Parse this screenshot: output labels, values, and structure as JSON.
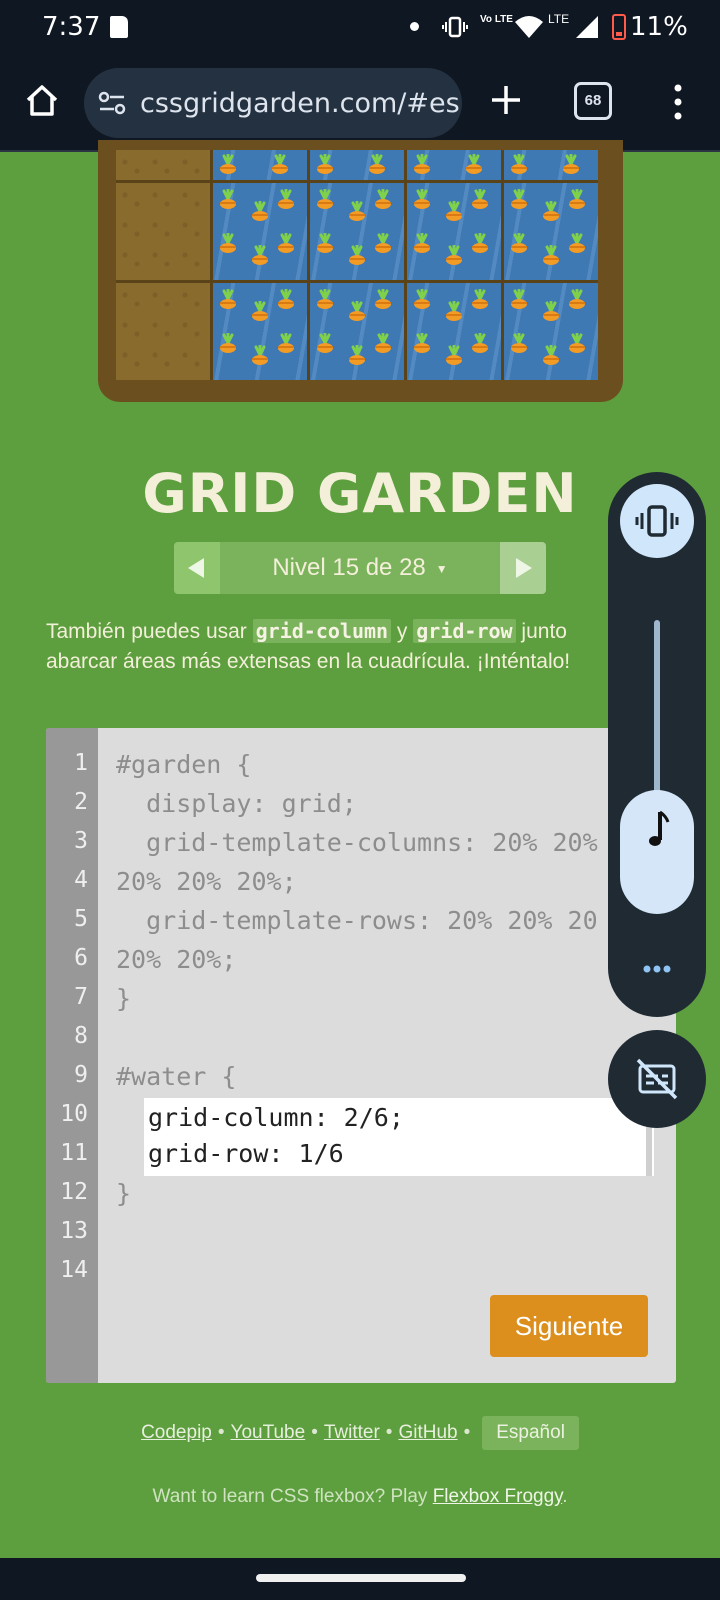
{
  "status_bar": {
    "time": "7:37",
    "lte_label": "LTE",
    "volte_label": "Vo LTE",
    "battery": "11%"
  },
  "browser": {
    "url": "cssgridgarden.com/#es",
    "tab_count": "68"
  },
  "game": {
    "title": "GRID GARDEN",
    "level": "Nivel 15 de 28",
    "instr_prefix": "También puedes usar ",
    "instr_code1": "grid-column",
    "instr_mid": " y ",
    "instr_code2": "grid-row",
    "instr_suffix": " junto",
    "instr_line2": "abarcar áreas más extensas en la cuadrícula. ¡Inténtalo!"
  },
  "editor": {
    "line_numbers": [
      "1",
      "2",
      "3",
      "4",
      "5",
      "6",
      "7",
      "8",
      "9",
      "10",
      "11",
      "12",
      "13",
      "14"
    ],
    "lines": {
      "l1": "#garden {",
      "l2": "  display: grid;",
      "l3": "  grid-template-columns: 20% 20%",
      "l4": "20% 20% 20%;",
      "l5": "  grid-template-rows: 20% 20% 20",
      "l6": "20% 20%;",
      "l7": "}",
      "l9": "#water {",
      "l12": "}"
    },
    "input_value": "grid-column: 2/6;\ngrid-row: 1/6",
    "next_label": "Siguiente"
  },
  "footer": {
    "links": [
      "Codepip",
      "YouTube",
      "Twitter",
      "GitHub"
    ],
    "language": "Español",
    "promo_prefix": "Want to learn CSS flexbox? Play ",
    "promo_link": "Flexbox Froggy",
    "promo_suffix": "."
  },
  "colors": {
    "background": "#5d9f3e",
    "accent": "#dc8f1c",
    "title": "#f3efd9"
  }
}
